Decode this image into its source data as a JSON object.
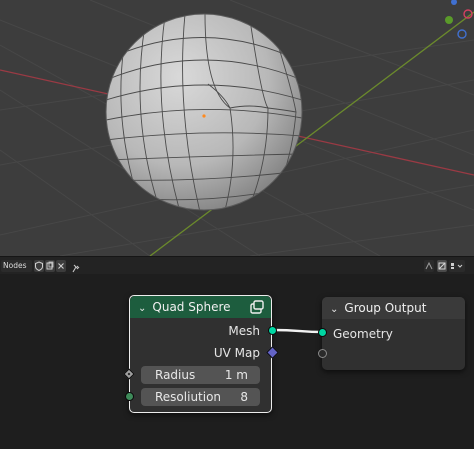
{
  "colors": {
    "viewport_bg": "#3d3d3d",
    "grid_line": "#474747",
    "x_axis": "#9a3a44",
    "y_axis": "#6b8a2c",
    "mesh_fill": "#bdbdbd",
    "geometry_node_header": "#1d5d3e",
    "output_node_header": "#3a3a3a",
    "geometry_socket": "#00d6a3",
    "vector_socket": "#6363c7",
    "integer_socket": "#3e8b5a",
    "selected_outline": "#ededed"
  },
  "node_editor_header": {
    "editor_label": "Nodes",
    "icons": [
      "shield-icon",
      "copy-icon",
      "close-icon",
      "pin-icon",
      "overlay-icon",
      "toggle-icon",
      "view-icon"
    ]
  },
  "nodes": {
    "quad_sphere": {
      "title": "Quad Sphere",
      "header_icon": "clipboard-icon",
      "outputs": [
        "Mesh",
        "UV Map"
      ],
      "inputs": [
        {
          "label": "Radius",
          "value": "1 m"
        },
        {
          "label": "Resoliution",
          "value": "8"
        }
      ]
    },
    "group_output": {
      "title": "Group Output",
      "inputs": [
        "Geometry"
      ]
    }
  }
}
